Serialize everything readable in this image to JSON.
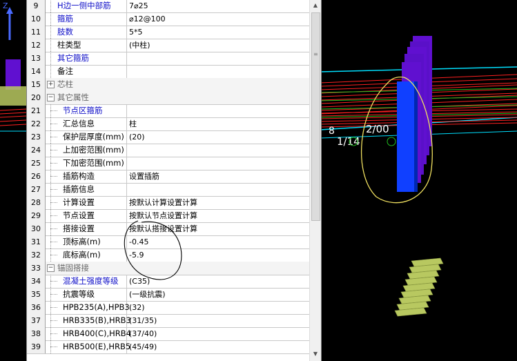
{
  "viewport": {
    "labels": [
      "1/14",
      "2/00"
    ]
  },
  "rows": [
    {
      "num": "9",
      "name": "H边一侧中部筋",
      "value": "7⌀25",
      "color": "blue",
      "indent": 1
    },
    {
      "num": "10",
      "name": "箍筋",
      "value": "⌀12@100",
      "color": "blue",
      "indent": 1
    },
    {
      "num": "11",
      "name": "肢数",
      "value": "5*5",
      "color": "blue",
      "indent": 1
    },
    {
      "num": "12",
      "name": "柱类型",
      "value": "(中柱)",
      "color": "black",
      "indent": 1
    },
    {
      "num": "13",
      "name": "其它箍筋",
      "value": "",
      "color": "blue",
      "indent": 1
    },
    {
      "num": "14",
      "name": "备注",
      "value": "",
      "color": "black",
      "indent": 1
    },
    {
      "num": "15",
      "name": "芯柱",
      "value": "",
      "color": "grey",
      "indent": 0,
      "expander": "+",
      "group": true
    },
    {
      "num": "20",
      "name": "其它属性",
      "value": "",
      "color": "grey",
      "indent": 0,
      "expander": "−",
      "group": true
    },
    {
      "num": "21",
      "name": "节点区箍筋",
      "value": "",
      "color": "blue",
      "indent": 2
    },
    {
      "num": "22",
      "name": "汇总信息",
      "value": "柱",
      "color": "black",
      "indent": 2
    },
    {
      "num": "23",
      "name": "保护层厚度(mm)",
      "value": "(20)",
      "color": "black",
      "indent": 2
    },
    {
      "num": "24",
      "name": "上加密范围(mm)",
      "value": "",
      "color": "black",
      "indent": 2
    },
    {
      "num": "25",
      "name": "下加密范围(mm)",
      "value": "",
      "color": "black",
      "indent": 2
    },
    {
      "num": "26",
      "name": "插筋构造",
      "value": "设置插筋",
      "color": "black",
      "indent": 2
    },
    {
      "num": "27",
      "name": "插筋信息",
      "value": "",
      "color": "black",
      "indent": 2
    },
    {
      "num": "28",
      "name": "计算设置",
      "value": "按默认计算设置计算",
      "color": "black",
      "indent": 2
    },
    {
      "num": "29",
      "name": "节点设置",
      "value": "按默认节点设置计算",
      "color": "black",
      "indent": 2
    },
    {
      "num": "30",
      "name": "搭接设置",
      "value": "按默认搭接设置计算",
      "color": "black",
      "indent": 2
    },
    {
      "num": "31",
      "name": "顶标高(m)",
      "value": "-0.45",
      "color": "black",
      "indent": 2
    },
    {
      "num": "32",
      "name": "底标高(m)",
      "value": "-5.9",
      "color": "black",
      "indent": 2
    },
    {
      "num": "33",
      "name": "锚固搭接",
      "value": "",
      "color": "grey",
      "indent": 0,
      "expander": "−",
      "group": true
    },
    {
      "num": "34",
      "name": "混凝土强度等级",
      "value": "(C35)",
      "color": "blue",
      "indent": 2
    },
    {
      "num": "35",
      "name": "抗震等级",
      "value": "(一级抗震)",
      "color": "black",
      "indent": 2
    },
    {
      "num": "36",
      "name": "HPB235(A),HPB3",
      "value": "(32)",
      "color": "black",
      "indent": 2
    },
    {
      "num": "37",
      "name": "HRB335(B),HRB3",
      "value": "(31/35)",
      "color": "black",
      "indent": 2
    },
    {
      "num": "38",
      "name": "HRB400(C),HRB4",
      "value": "(37/40)",
      "color": "black",
      "indent": 2
    },
    {
      "num": "39",
      "name": "HRB500(E),HRB5",
      "value": "(45/49)",
      "color": "black",
      "indent": 2
    }
  ],
  "colors": {
    "rebar_red": "#ff2020",
    "rebar_green": "#20c020",
    "cyan_line": "#00e0ff",
    "column_blue": "#1040ff",
    "column_purple": "#6010d0",
    "stirrup_olive": "#b8c860",
    "annotation_yellow": "#f0e060"
  },
  "scrollbar": {
    "up": "▲",
    "down": "▼"
  }
}
